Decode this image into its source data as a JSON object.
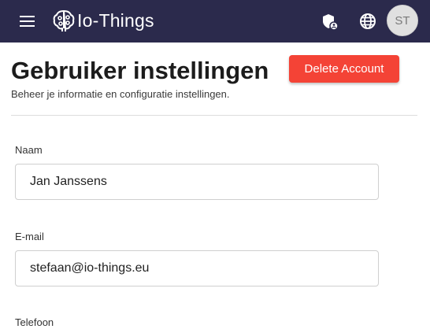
{
  "header": {
    "brand": "Io-Things",
    "avatar_initials": "ST",
    "background_color": "#2b2a4c",
    "icons": [
      "menu-icon",
      "brain-logo-icon",
      "admin-shield-icon",
      "globe-icon"
    ]
  },
  "page": {
    "title": "Gebruiker instellingen",
    "subtitle": "Beheer je informatie en configuratie instellingen.",
    "delete_button_label": "Delete Account",
    "delete_button_color": "#f44336"
  },
  "form": {
    "name": {
      "label": "Naam",
      "value": "Jan Janssens"
    },
    "email": {
      "label": "E-mail",
      "value": "stefaan@io-things.eu"
    },
    "phone": {
      "label": "Telefoon"
    }
  }
}
